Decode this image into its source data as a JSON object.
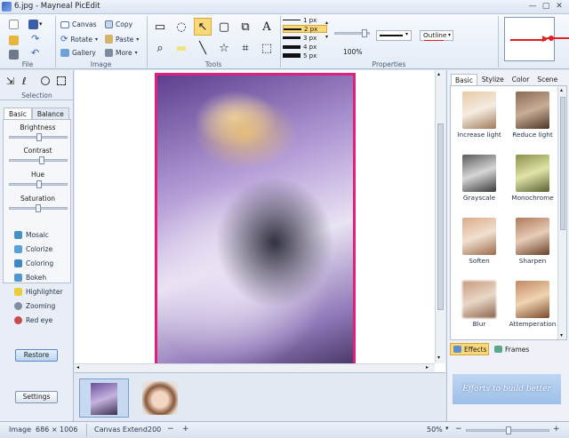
{
  "app": {
    "title": "6.jpg - Mayneal PicEdit"
  },
  "window": {
    "minimize": "—",
    "maximize": "▢",
    "close": "✕"
  },
  "ribbon": {
    "file": {
      "label": "File",
      "items": [
        {
          "name": "new-icon",
          "color": "#f5f5f5"
        },
        {
          "name": "save-icon",
          "color": "#3b5ea8"
        },
        {
          "name": "open-icon",
          "color": "#e9b53a"
        },
        {
          "name": "redo-icon",
          "color": "#2f67c9"
        },
        {
          "name": "print-icon",
          "color": "#6d7a8c"
        },
        {
          "name": "undo-icon",
          "color": "#2f67c9"
        }
      ]
    },
    "image": {
      "label": "Image",
      "canvas": "Canvas",
      "copy": "Copy",
      "rotate": "Rotate",
      "paste": "Paste",
      "gallery": "Gallery",
      "more": "More"
    },
    "tools": {
      "label": "Tools",
      "icons": [
        "select-rect-icon",
        "lasso-shape-icon",
        "line-tool-icon",
        "rounded-rect-icon",
        "clone-stamp-icon",
        "text-tool-icon",
        "zoom-icon",
        "highlighter-icon",
        "straight-line-icon",
        "star-icon",
        "crop-icon",
        "paint-bucket-icon"
      ],
      "glyphs": [
        "▭",
        "◌",
        "↖",
        "▢",
        "⧉",
        "A",
        "⌕",
        "▬",
        "╲",
        "☆",
        "⌗",
        "⬚"
      ]
    },
    "properties": {
      "label": "Properties",
      "line_sizes": [
        "1 px",
        "2 px",
        "3 px",
        "4 px",
        "5 px"
      ],
      "selected_size": "2 px",
      "opacity": "100%",
      "outline": "Outline"
    }
  },
  "left": {
    "selection_label": "Selection",
    "tabs": [
      "Basic",
      "Balance"
    ],
    "adjust": [
      {
        "label": "Brightness",
        "value": 0.5
      },
      {
        "label": "Contrast",
        "value": 0.55
      },
      {
        "label": "Hue",
        "value": 0.5
      },
      {
        "label": "Saturation",
        "value": 0.48
      }
    ],
    "effects": [
      {
        "label": "Mosaic",
        "icon": "mosaic-icon",
        "color": "#4a90c8"
      },
      {
        "label": "Colorize",
        "icon": "colorize-icon",
        "color": "#5aa0d8"
      },
      {
        "label": "Coloring",
        "icon": "coloring-icon",
        "color": "#3f86c4"
      },
      {
        "label": "Bokeh",
        "icon": "bokeh-icon",
        "color": "#4f96d0"
      },
      {
        "label": "Highlighter",
        "icon": "highlighter-pen-icon",
        "color": "#e8cf3a"
      },
      {
        "label": "Zooming",
        "icon": "zooming-icon",
        "color": "#7e8ea6"
      },
      {
        "label": "Red eye",
        "icon": "red-eye-icon",
        "color": "#c84a4a"
      }
    ],
    "restore": "Restore",
    "settings": "Settings"
  },
  "right": {
    "tabs": [
      "Basic",
      "Stylize",
      "Color",
      "Scene"
    ],
    "effects": [
      {
        "label": "Increase light",
        "color": "#e7c9a8"
      },
      {
        "label": "Reduce light",
        "color": "#8a6a55"
      },
      {
        "label": "Grayscale",
        "color": "#8f8f8f"
      },
      {
        "label": "Monochrome",
        "color": "#b8bf6a"
      },
      {
        "label": "Soften",
        "color": "#d9ab8a"
      },
      {
        "label": "Sharpen",
        "color": "#b07a5a"
      },
      {
        "label": "Blur",
        "color": "#c69a7e"
      },
      {
        "label": "Attemperation",
        "color": "#c08a62"
      }
    ],
    "bottom_tabs": {
      "effects": "Effects",
      "frames": "Frames"
    },
    "banner": "Efforts to build better"
  },
  "status": {
    "image_label": "Image",
    "image_size": "686 × 1006",
    "canvas_extend_label": "Canvas Extend",
    "canvas_extend_value": "200",
    "minus": "−",
    "plus": "+",
    "zoom": "50%",
    "zoom_level": 0.5
  },
  "colors": {
    "accent_selected": "#fbd97a",
    "frame_pink": "#e0207a",
    "arrow_red": "#e02020"
  }
}
